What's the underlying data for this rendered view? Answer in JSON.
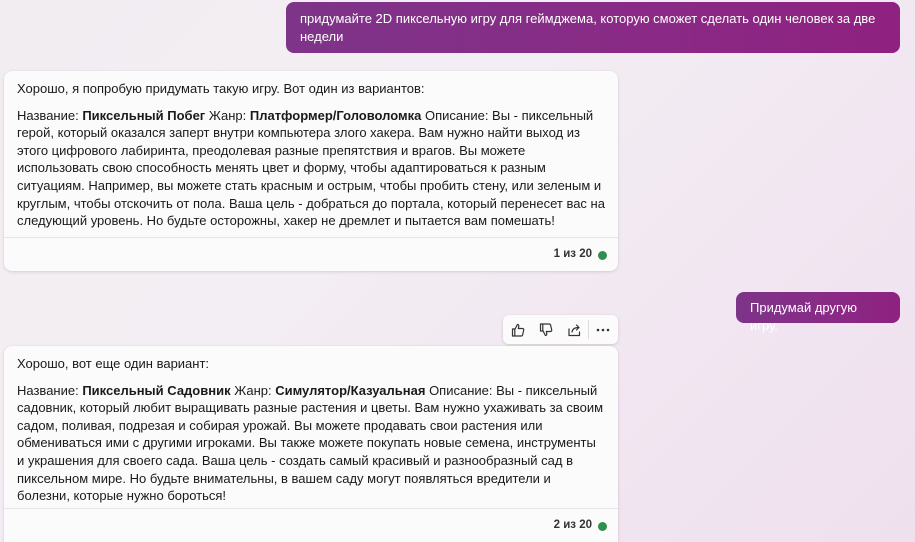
{
  "conversation": {
    "user_message_1": "придумайте 2D пиксельную игру для геймджема, которую сможет сделать один человек за две недели",
    "bot_message_1": {
      "intro": "Хорошо, я попробую придумать такую игру. Вот один из вариантов:",
      "name_label": "Название: ",
      "name_value": "Пиксельный Побег",
      "genre_label": " Жанр: ",
      "genre_value": "Платформер/Головоломка",
      "description": " Описание: Вы - пиксельный герой, который оказался заперт внутри компьютера злого хакера. Вам нужно найти выход из этого цифрового лабиринта, преодолевая разные препятствия и врагов. Вы можете использовать свою способность менять цвет и форму, чтобы адаптироваться к разным ситуациям. Например, вы можете стать красным и острым, чтобы пробить стену, или зеленым и круглым, чтобы отскочить от пола. Ваша цель - добраться до портала, который перенесет вас на следующий уровень. Но будьте осторожны, хакер не дремлет и пытается вам помешать!",
      "counter": "1 из 20"
    },
    "user_message_2": "Придумай другую игру.",
    "bot_message_2": {
      "intro": "Хорошо, вот еще один вариант:",
      "name_label": "Название: ",
      "name_value": "Пиксельный Садовник",
      "genre_label": " Жанр: ",
      "genre_value": "Симулятор/Казуальная",
      "description": " Описание: Вы - пиксельный садовник, который любит выращивать разные растения и цветы. Вам нужно ухаживать за своим садом, поливая, подрезая и собирая урожай. Вы можете продавать свои растения или обмениваться ими с другими игроками. Вы также можете покупать новые семена, инструменты и украшения для своего сада. Ваша цель - создать самый красивый и разнообразный сад в пиксельном мире. Но будьте внимательны, в вашем саду могут появляться вредители и болезни, которые нужно бороться!",
      "counter": "2 из 20"
    }
  },
  "action_bar": {
    "icons": [
      "thumbs-up-icon",
      "thumbs-down-icon",
      "share-icon",
      "more-icon"
    ]
  },
  "colors": {
    "user_bubble": "#8a2a86",
    "status_dot": "#2f8f4e",
    "card_bg": "#fbfbfc"
  }
}
